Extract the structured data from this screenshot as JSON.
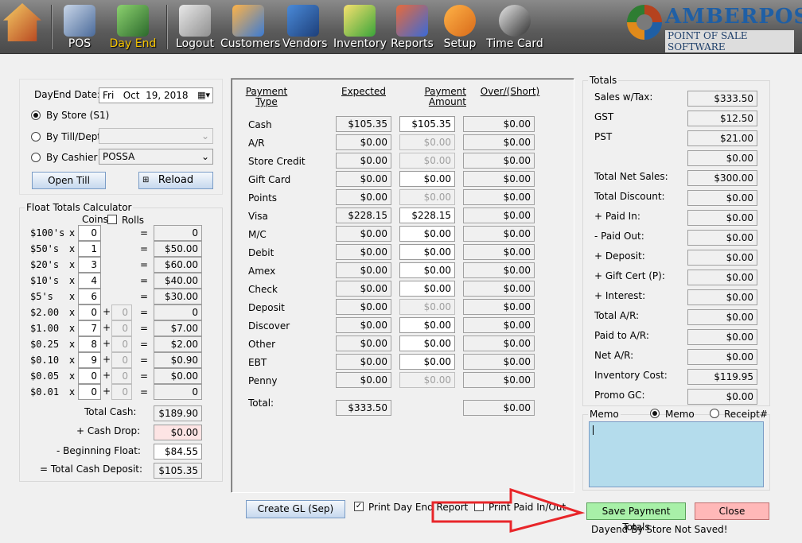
{
  "toolbar": {
    "items": [
      {
        "label": "",
        "icon": "home-icon"
      },
      {
        "label": "POS",
        "icon": "pos-register-icon"
      },
      {
        "label": "Day End",
        "icon": "day-end-calculator-icon",
        "active": true
      },
      {
        "label": "Logout",
        "icon": "padlock-icon"
      },
      {
        "label": "Customers",
        "icon": "customers-icon"
      },
      {
        "label": "Vendors",
        "icon": "vendors-icon"
      },
      {
        "label": "Inventory",
        "icon": "inventory-boxes-icon"
      },
      {
        "label": "Reports",
        "icon": "reports-icon"
      },
      {
        "label": "Setup",
        "icon": "setup-gear-icon"
      },
      {
        "label": "Time Card",
        "icon": "time-card-clock-icon"
      }
    ],
    "active_color": "#f5c400"
  },
  "logo": {
    "name_a": "AMBER",
    "name_b": "POS",
    "tagline": "POINT OF SALE SOFTWARE"
  },
  "dayend": {
    "date_label": "DayEnd Date:",
    "date_value": "Fri   Oct  19, 2018",
    "by_store": "By Store (S1)",
    "by_till": "By Till/Dept",
    "by_till_value": "",
    "by_cashier": "By Cashier",
    "cashier_value": "POSSA",
    "open_till": "Open Till",
    "reload": "Reload"
  },
  "float_calc": {
    "title": "Float Totals Calculator",
    "coins_label": "Coins",
    "rolls_label": "Rolls",
    "rows": [
      {
        "denom": "$100's",
        "count": "0",
        "rolls": "",
        "total": "0"
      },
      {
        "denom": "$50's",
        "count": "1",
        "rolls": "",
        "total": "$50.00"
      },
      {
        "denom": "$20's",
        "count": "3",
        "rolls": "",
        "total": "$60.00"
      },
      {
        "denom": "$10's",
        "count": "4",
        "rolls": "",
        "total": "$40.00"
      },
      {
        "denom": "$5's",
        "count": "6",
        "rolls": "",
        "total": "$30.00"
      },
      {
        "denom": "$2.00",
        "count": "0",
        "rolls": "0",
        "total": "0"
      },
      {
        "denom": "$1.00",
        "count": "7",
        "rolls": "0",
        "total": "$7.00"
      },
      {
        "denom": "$0.25",
        "count": "8",
        "rolls": "0",
        "total": "$2.00"
      },
      {
        "denom": "$0.10",
        "count": "9",
        "rolls": "0",
        "total": "$0.90"
      },
      {
        "denom": "$0.05",
        "count": "0",
        "rolls": "0",
        "total": "$0.00"
      },
      {
        "denom": "$0.01",
        "count": "0",
        "rolls": "0",
        "total": "0"
      }
    ],
    "total_cash_label": "Total Cash:",
    "total_cash": "$189.90",
    "cash_drop_label": "+ Cash Drop:",
    "cash_drop": "$0.00",
    "beginning_float_label": "- Beginning Float:",
    "beginning_float": "$84.55",
    "total_deposit_label": "= Total Cash Deposit:",
    "total_deposit": "$105.35"
  },
  "payments": {
    "headers": {
      "type": [
        "Payment",
        "Type"
      ],
      "expected": "Expected",
      "amount": [
        "Payment",
        "Amount"
      ],
      "over": "Over/(Short)"
    },
    "rows": [
      {
        "type": "Cash",
        "expected": "$105.35",
        "amount": "$105.35",
        "editable": true,
        "over": "$0.00"
      },
      {
        "type": "A/R",
        "expected": "$0.00",
        "amount": "$0.00",
        "editable": false,
        "over": "$0.00"
      },
      {
        "type": "Store Credit",
        "expected": "$0.00",
        "amount": "$0.00",
        "editable": false,
        "over": "$0.00"
      },
      {
        "type": "Gift Card",
        "expected": "$0.00",
        "amount": "$0.00",
        "editable": true,
        "over": "$0.00"
      },
      {
        "type": "Points",
        "expected": "$0.00",
        "amount": "$0.00",
        "editable": false,
        "over": "$0.00"
      },
      {
        "type": "Visa",
        "expected": "$228.15",
        "amount": "$228.15",
        "editable": true,
        "over": "$0.00"
      },
      {
        "type": "M/C",
        "expected": "$0.00",
        "amount": "$0.00",
        "editable": true,
        "over": "$0.00"
      },
      {
        "type": "Debit",
        "expected": "$0.00",
        "amount": "$0.00",
        "editable": true,
        "over": "$0.00"
      },
      {
        "type": "Amex",
        "expected": "$0.00",
        "amount": "$0.00",
        "editable": true,
        "over": "$0.00"
      },
      {
        "type": "Check",
        "expected": "$0.00",
        "amount": "$0.00",
        "editable": true,
        "over": "$0.00"
      },
      {
        "type": "Deposit",
        "expected": "$0.00",
        "amount": "$0.00",
        "editable": false,
        "over": "$0.00"
      },
      {
        "type": "Discover",
        "expected": "$0.00",
        "amount": "$0.00",
        "editable": true,
        "over": "$0.00"
      },
      {
        "type": "Other",
        "expected": "$0.00",
        "amount": "$0.00",
        "editable": true,
        "over": "$0.00"
      },
      {
        "type": "EBT",
        "expected": "$0.00",
        "amount": "$0.00",
        "editable": true,
        "over": "$0.00"
      },
      {
        "type": "Penny",
        "expected": "$0.00",
        "amount": "$0.00",
        "editable": false,
        "over": "$0.00"
      }
    ],
    "total_label": "Total:",
    "total_expected": "$333.50",
    "total_over": "$0.00"
  },
  "totals": {
    "title": "Totals",
    "rows": [
      {
        "label": "Sales w/Tax:",
        "value": "$333.50"
      },
      {
        "label": "GST",
        "value": "$12.50"
      },
      {
        "label": "PST",
        "value": "$21.00"
      },
      {
        "label": "",
        "value": "$0.00"
      },
      {
        "label": "Total Net Sales:",
        "value": "$300.00"
      },
      {
        "label": "Total Discount:",
        "value": "$0.00"
      },
      {
        "label": "+ Paid In:",
        "value": "$0.00"
      },
      {
        "label": "- Paid Out:",
        "value": "$0.00"
      },
      {
        "label": "+ Deposit:",
        "value": "$0.00"
      },
      {
        "label": "+ Gift Cert (P):",
        "value": "$0.00"
      },
      {
        "label": "+ Interest:",
        "value": "$0.00"
      },
      {
        "label": "Total A/R:",
        "value": "$0.00"
      },
      {
        "label": "Paid to A/R:",
        "value": "$0.00"
      },
      {
        "label": "Net A/R:",
        "value": "$0.00"
      },
      {
        "label": "Inventory Cost:",
        "value": "$119.95"
      },
      {
        "label": "Promo GC:",
        "value": "$0.00"
      }
    ]
  },
  "memo": {
    "title": "Memo",
    "opt_memo": "Memo",
    "opt_receipt": "Receipt#",
    "value": ""
  },
  "bottom": {
    "create_gl": "Create GL (Sep)",
    "print_report": "Print Day End Report",
    "print_report_checked": true,
    "print_paid": "Print Paid In/Out",
    "print_paid_checked": false,
    "save": "Save Payment Totals",
    "close": "Close",
    "status": "Dayend By Store Not Saved!"
  },
  "colors": {
    "save_bg": "#a8f0a8",
    "close_bg": "#ffb8b8",
    "memo_bg": "#b4dcec",
    "arrow": "#e8262a"
  }
}
